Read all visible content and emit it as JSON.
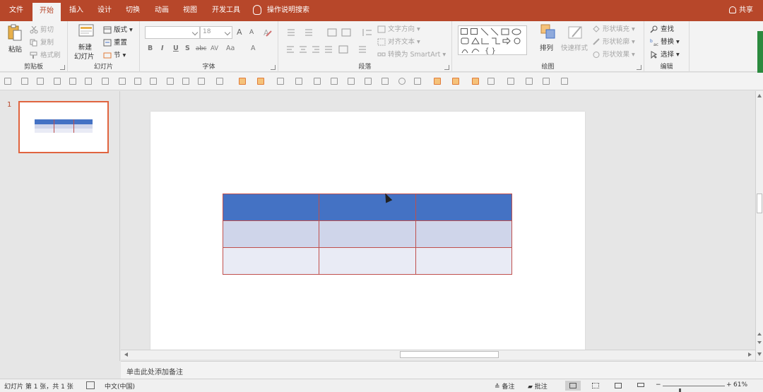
{
  "tabs": [
    {
      "label": "文件",
      "active": false
    },
    {
      "label": "开始",
      "active": true
    },
    {
      "label": "插入",
      "active": false
    },
    {
      "label": "设计",
      "active": false
    },
    {
      "label": "切换",
      "active": false
    },
    {
      "label": "动画",
      "active": false
    },
    {
      "label": "视图",
      "active": false
    },
    {
      "label": "开发工具",
      "active": false
    }
  ],
  "tellme": "操作说明搜索",
  "share": "共享",
  "ribbon": {
    "clipboard": {
      "label": "剪贴板",
      "paste": "粘贴",
      "cut": "剪切",
      "copy": "复制",
      "format_painter": "格式刷"
    },
    "slides": {
      "label": "幻灯片",
      "new_slide_1": "新建",
      "new_slide_2": "幻灯片",
      "layout": "版式",
      "reset": "重置",
      "section": "节"
    },
    "font": {
      "label": "字体",
      "font_name": "",
      "font_size": "18",
      "grow": "A",
      "shrink": "A",
      "bold": "B",
      "italic": "I",
      "underline": "U",
      "shadow": "S",
      "strike": "abc",
      "spacing": "AV",
      "case": "Aa",
      "color": "A"
    },
    "paragraph": {
      "label": "段落",
      "text_direction": "文字方向",
      "align_text": "对齐文本",
      "smartart": "转换为 SmartArt"
    },
    "drawing": {
      "label": "绘图",
      "arrange": "排列",
      "quick_styles": "快速样式",
      "shape_fill": "形状填充",
      "shape_outline": "形状轮廓",
      "shape_effects": "形状效果"
    },
    "editing": {
      "label": "编辑",
      "find": "查找",
      "replace": "替换",
      "select": "选择"
    }
  },
  "slides_pane": {
    "slide_number": "1"
  },
  "notes_placeholder": "单击此处添加备注",
  "status": {
    "slide_info": "幻灯片 第 1 张，共 1 张",
    "language": "中文(中国)",
    "notes": "备注",
    "comments": "批注",
    "zoom_minus": "−",
    "zoom_plus": "+",
    "zoom": "61%"
  },
  "colors": {
    "accent": "#b7472a",
    "table_header": "#4472c4",
    "table_row_1": "#cfd5ea",
    "table_row_2": "#e9ebf5",
    "table_border": "#c0504d"
  }
}
